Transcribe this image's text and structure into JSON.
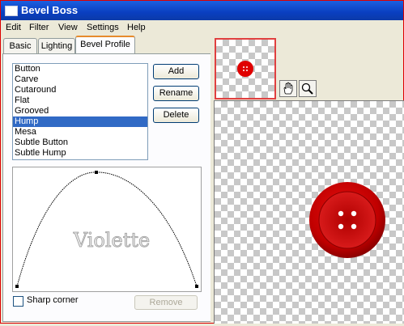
{
  "window": {
    "title": "Bevel Boss"
  },
  "menu": [
    "Edit",
    "Filter",
    "View",
    "Settings",
    "Help"
  ],
  "tabs": [
    "Basic",
    "Lighting",
    "Bevel Profile"
  ],
  "profiles": {
    "items": [
      "Button",
      "Carve",
      "Cutaround",
      "Flat",
      "Grooved",
      "Hump",
      "Mesa",
      "Subtle Button",
      "Subtle Hump"
    ],
    "selected": "Hump"
  },
  "buttons": {
    "add": "Add",
    "rename": "Rename",
    "delete": "Delete",
    "remove": "Remove"
  },
  "curve": {
    "watermark": "Violette"
  },
  "sharp_corner": {
    "label": "Sharp corner",
    "checked": false
  },
  "colors": {
    "accent": "#316ac5",
    "title_bar": "#0a3fc0",
    "button_red": "#cc0000"
  },
  "tools": [
    "hand-tool-icon",
    "zoom-tool-icon"
  ]
}
